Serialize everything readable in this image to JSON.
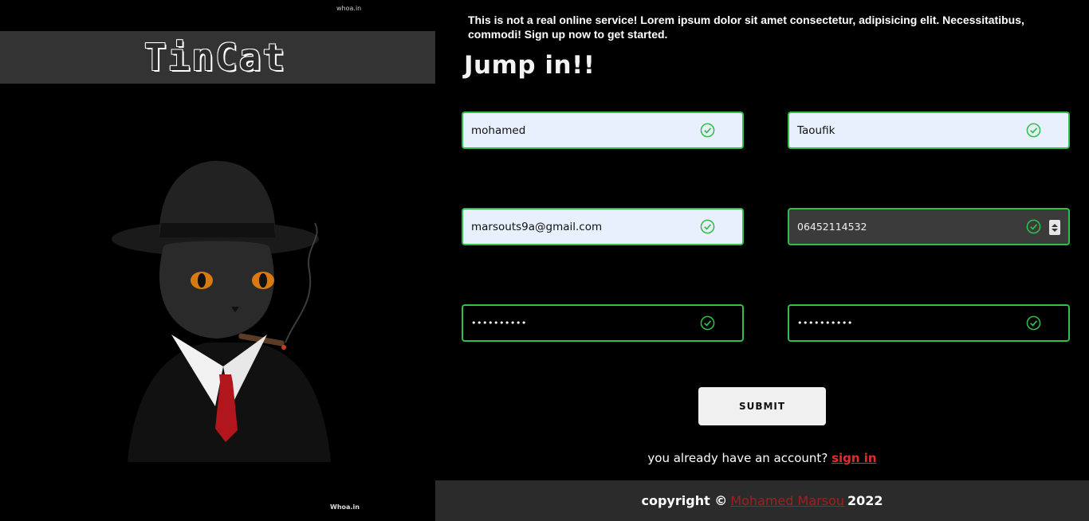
{
  "left": {
    "watermark_top": "whoa.in",
    "logo": "TinCat",
    "watermark_bottom": "Whoa.in"
  },
  "intro": "This is not a real online service! Lorem ipsum dolor sit amet consectetur, adipisicing elit. Necessitatibus, commodi! Sign up now to get started.",
  "heading": "Jump in!!",
  "form": {
    "first_name": "mohamed",
    "last_name": "Taoufik",
    "email": "marsouts9a@gmail.com",
    "phone": "06452114532",
    "password": "••••••••••",
    "confirm_password": "••••••••••",
    "submit_label": "SUBMIT"
  },
  "signin": {
    "prompt": "you already have an account?",
    "link": "sign in"
  },
  "footer": {
    "prefix": "copyright ©",
    "author": "Mohamed Marsou",
    "year": "2022"
  },
  "colors": {
    "valid_border": "#2fbf4a",
    "link_red": "#e52b2b",
    "author_red": "#a11f1f",
    "autofill_bg": "#e8f0fe"
  }
}
